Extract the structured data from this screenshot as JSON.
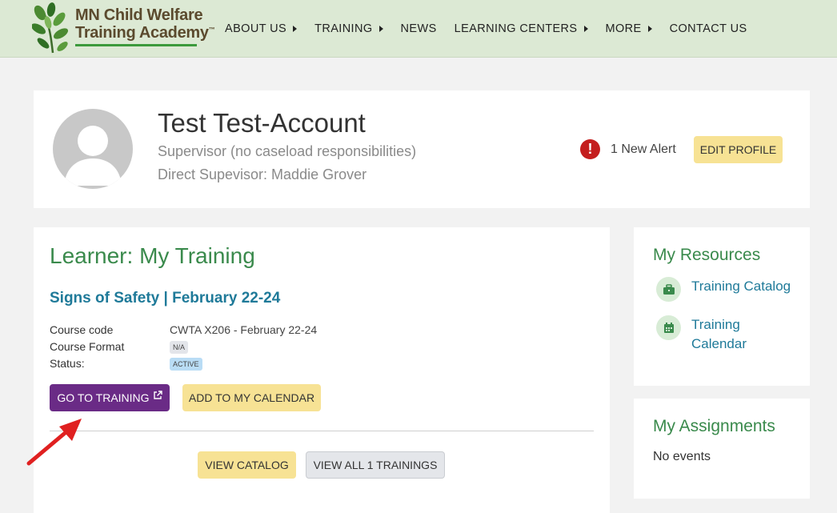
{
  "header": {
    "logo": {
      "line1": "MN Child Welfare",
      "line2": "Training Academy",
      "tm": "™"
    },
    "nav": [
      {
        "label": "ABOUT US",
        "has_caret": true
      },
      {
        "label": "TRAINING",
        "has_caret": true
      },
      {
        "label": "NEWS",
        "has_caret": false
      },
      {
        "label": "LEARNING CENTERS",
        "has_caret": true
      },
      {
        "label": "MORE",
        "has_caret": true
      },
      {
        "label": "CONTACT US",
        "has_caret": false
      }
    ]
  },
  "profile": {
    "name": "Test Test-Account",
    "role": "Supervisor (no caseload responsibilities)",
    "supervisor": "Direct Supevisor: Maddie Grover",
    "alert_icon": "!",
    "alert_text": "1 New Alert",
    "edit_label": "EDIT PROFILE"
  },
  "training": {
    "title": "Learner: My Training",
    "course_title": "Signs of Safety | February 22-24",
    "details": {
      "code_label": "Course code",
      "code_value": "CWTA X206 - February 22-24",
      "format_label": "Course Format",
      "format_value": "N/A",
      "status_label": "Status:",
      "status_value": "ACTIVE"
    },
    "go_label": "GO TO TRAINING",
    "add_calendar_label": "ADD TO MY CALENDAR",
    "view_catalog_label": "VIEW CATALOG",
    "view_all_label": "VIEW ALL 1 TRAININGS"
  },
  "resources": {
    "title": "My Resources",
    "items": [
      {
        "label": "Training Catalog",
        "icon": "briefcase-icon"
      },
      {
        "label": "Training Calendar",
        "icon": "calendar-icon"
      }
    ]
  },
  "assignments": {
    "title": "My Assignments",
    "empty_text": "No events"
  },
  "colors": {
    "header_bg": "#dce9d4",
    "green_title": "#3a8a4c",
    "link_blue": "#1f7a99",
    "purple_button": "#6a2b86",
    "yellow_button": "#f7e294",
    "alert_red": "#c41e1e",
    "annotation_arrow": "#e02020"
  }
}
